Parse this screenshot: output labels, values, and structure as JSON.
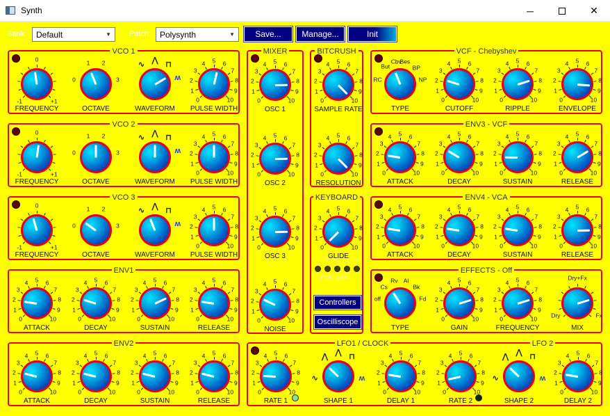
{
  "window": {
    "title": "Synth",
    "minimize": "─",
    "close": "✕"
  },
  "toolbar": {
    "bank_label": "Bank:",
    "bank_value": "Default",
    "patch_label": "Patch:",
    "patch_value": "Polysynth",
    "save": "Save...",
    "manage": "Manage...",
    "init": "Init"
  },
  "panels": [
    {
      "id": "vco1",
      "title": "VCO 1",
      "led": true,
      "knobs": [
        {
          "label": "FREQUENCY",
          "value": 0.47,
          "scale": "freq"
        },
        {
          "label": "OCTAVE",
          "value": 0.42,
          "scale": "octave"
        },
        {
          "label": "WAVEFORM",
          "value": 0.72,
          "scale": "wave"
        },
        {
          "label": "PULSE WIDTH",
          "value": 0.55,
          "scale": "ten"
        }
      ]
    },
    {
      "id": "vco2",
      "title": "VCO 2",
      "led": true,
      "knobs": [
        {
          "label": "FREQUENCY",
          "value": 0.53,
          "scale": "freq"
        },
        {
          "label": "OCTAVE",
          "value": 0.5,
          "scale": "octave"
        },
        {
          "label": "WAVEFORM",
          "value": 0.5,
          "scale": "wave"
        },
        {
          "label": "PULSE WIDTH",
          "value": 0.5,
          "scale": "ten"
        }
      ]
    },
    {
      "id": "vco3",
      "title": "VCO 3",
      "led": true,
      "knobs": [
        {
          "label": "FREQUENCY",
          "value": 0.44,
          "scale": "freq"
        },
        {
          "label": "OCTAVE",
          "value": 0.3,
          "scale": "octave"
        },
        {
          "label": "WAVEFORM",
          "value": 0.42,
          "scale": "wave"
        },
        {
          "label": "PULSE WIDTH",
          "value": 0.5,
          "scale": "ten"
        }
      ]
    },
    {
      "id": "env1",
      "title": "ENV1",
      "led": false,
      "knobs": [
        {
          "label": "ATTACK",
          "value": 0.2,
          "scale": "ten"
        },
        {
          "label": "DECAY",
          "value": 0.23,
          "scale": "ten"
        },
        {
          "label": "SUSTAIN",
          "value": 0.74,
          "scale": "ten"
        },
        {
          "label": "RELEASE",
          "value": 0.2,
          "scale": "ten"
        }
      ]
    },
    {
      "id": "env2",
      "title": "ENV2",
      "led": false,
      "knobs": [
        {
          "label": "ATTACK",
          "value": 0.22,
          "scale": "ten"
        },
        {
          "label": "DECAY",
          "value": 0.22,
          "scale": "ten"
        },
        {
          "label": "SUSTAIN",
          "value": 0.22,
          "scale": "ten"
        },
        {
          "label": "RELEASE",
          "value": 0.22,
          "scale": "ten"
        }
      ]
    },
    {
      "id": "mixer",
      "title": "MIXER",
      "led": true,
      "knobs": [
        {
          "label": "OSC 1",
          "value": 0.83,
          "scale": "ten"
        },
        {
          "label": "OSC 2",
          "value": 0.83,
          "scale": "ten"
        },
        {
          "label": "OSC 3",
          "value": 0.83,
          "scale": "ten"
        },
        {
          "label": "NOISE",
          "value": 0.26,
          "scale": "ten"
        }
      ]
    },
    {
      "id": "bitcrush",
      "title": "BITCRUSH",
      "led": true,
      "knobs": [
        {
          "label": "SAMPLE RATE",
          "value": 1.0,
          "scale": "ten"
        },
        {
          "label": "RESOLUTION",
          "value": 1.0,
          "scale": "ten"
        }
      ]
    },
    {
      "id": "keyboard",
      "title": "KEYBOARD",
      "led": false,
      "knobs": [
        {
          "label": "GLIDE",
          "value": 0.0,
          "scale": "ten"
        }
      ],
      "polygate_label": "Poly-gate",
      "polygate_scale": [
        "1",
        "2",
        "3",
        "4",
        "5"
      ],
      "controllers": "Controllers",
      "oscilloscope": "Oscilliscope"
    },
    {
      "id": "vcf",
      "title": "VCF - Chebyshev",
      "led": true,
      "knobs": [
        {
          "label": "TYPE",
          "value": 0.42,
          "scale": "ftype"
        },
        {
          "label": "CUTOFF",
          "value": 0.23,
          "scale": "ten"
        },
        {
          "label": "RIPPLE",
          "value": 0.77,
          "scale": "ten"
        },
        {
          "label": "ENVELOPE",
          "value": 0.85,
          "scale": "ten"
        }
      ]
    },
    {
      "id": "env3",
      "title": "ENV3 - VCF",
      "led": true,
      "knobs": [
        {
          "label": "ATTACK",
          "value": 0.2,
          "scale": "ten"
        },
        {
          "label": "DECAY",
          "value": 0.28,
          "scale": "ten"
        },
        {
          "label": "SUSTAIN",
          "value": 0.17,
          "scale": "ten"
        },
        {
          "label": "RELEASE",
          "value": 0.72,
          "scale": "ten"
        }
      ]
    },
    {
      "id": "env4",
      "title": "ENV4 - VCA",
      "led": true,
      "knobs": [
        {
          "label": "ATTACK",
          "value": 0.2,
          "scale": "ten"
        },
        {
          "label": "DECAY",
          "value": 0.2,
          "scale": "ten"
        },
        {
          "label": "SUSTAIN",
          "value": 0.2,
          "scale": "ten"
        },
        {
          "label": "RELEASE",
          "value": 0.83,
          "scale": "ten"
        }
      ]
    },
    {
      "id": "effects",
      "title": "EFFECTS - Off",
      "led": true,
      "knobs": [
        {
          "label": "TYPE",
          "value": 0.38,
          "scale": "etype"
        },
        {
          "label": "GAIN",
          "value": 0.77,
          "scale": "ten"
        },
        {
          "label": "FREQUENCY",
          "value": 0.77,
          "scale": "ten"
        },
        {
          "label": "MIX",
          "value": 0.77,
          "scale": "mix"
        }
      ]
    },
    {
      "id": "lfo",
      "title": "LFO1 / CLOCK",
      "title2": "LFO 2",
      "led": true,
      "knobs": [
        {
          "label": "RATE 1",
          "value": 0.18,
          "scale": "ten"
        },
        {
          "label": "SHAPE 1",
          "value": 0.33,
          "scale": "lfowave"
        },
        {
          "label": "DELAY 1",
          "value": 0.2,
          "scale": "ten"
        },
        {
          "label": "RATE 2",
          "value": 0.12,
          "scale": "ten"
        },
        {
          "label": "SHAPE 2",
          "value": 0.33,
          "scale": "lfowave"
        },
        {
          "label": "DELAY 2",
          "value": 0.2,
          "scale": "ten"
        }
      ]
    }
  ],
  "scales": {
    "ten": [
      "0",
      "1",
      "2",
      "3",
      "4",
      "5",
      "6",
      "7",
      "8",
      "9",
      "10"
    ],
    "freq": [
      "-1",
      "0",
      "+1"
    ],
    "octave": [
      "0",
      "1",
      "2",
      "3"
    ],
    "ftype": [
      "RC",
      "But",
      "Cbv",
      "Bes",
      "BP",
      "NP"
    ],
    "etype": [
      "off",
      "Cs",
      "Rv",
      "Al",
      "Bk",
      "Fd"
    ],
    "mix": [
      "Dry",
      "Dry+Fx",
      "Fx"
    ]
  },
  "colors": {
    "background": "#ffff00",
    "panel_border": "#e6001a",
    "button": "#000080",
    "knob_ring": "#e00018"
  }
}
